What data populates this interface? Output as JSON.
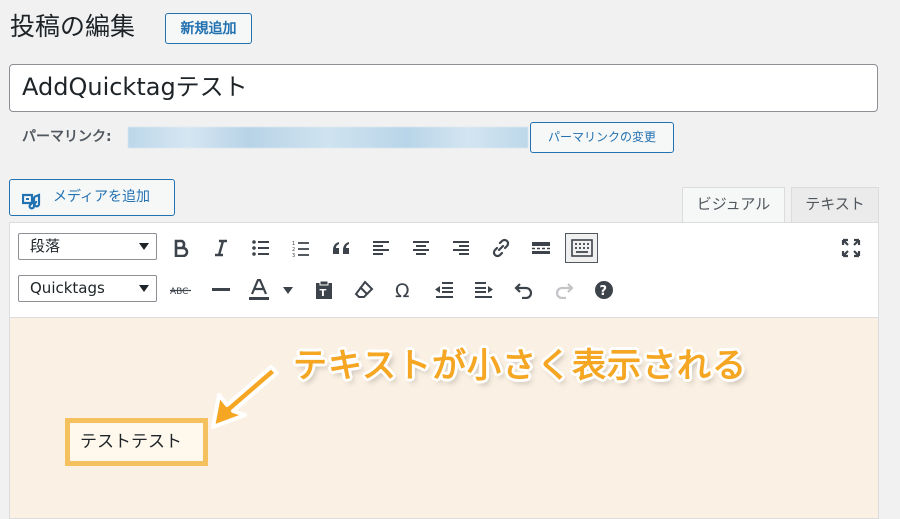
{
  "header": {
    "title": "投稿の編集",
    "add_new_label": "新規追加"
  },
  "post": {
    "title_value": "AddQuicktagテスト"
  },
  "permalink": {
    "label": "パーマリンク:",
    "change_button": "パーマリンクの変更"
  },
  "media": {
    "add_media_label": "メディアを追加"
  },
  "editor_tabs": {
    "visual": "ビジュアル",
    "text": "テキスト"
  },
  "toolbar": {
    "format_select": "段落",
    "quicktags_select": "Quicktags",
    "row1_icons": [
      "bold-icon",
      "italic-icon",
      "bullet-list-icon",
      "numbered-list-icon",
      "blockquote-icon",
      "align-left-icon",
      "align-center-icon",
      "align-right-icon",
      "link-icon",
      "read-more-icon",
      "toolbar-toggle-icon",
      "fullscreen-icon"
    ],
    "row2_icons": [
      "strikethrough-icon",
      "horizontal-line-icon",
      "text-color-icon",
      "paste-text-icon",
      "clear-formatting-icon",
      "special-character-icon",
      "outdent-icon",
      "indent-icon",
      "undo-icon",
      "redo-icon",
      "help-icon"
    ]
  },
  "content": {
    "callout": "テキストが小さく表示される",
    "highlighted_text": "テストテスト"
  },
  "colors": {
    "accent": "#2271b1",
    "callout": "#f5a623",
    "highlight_border": "#f5c05e",
    "editor_background": "#faf0e3"
  }
}
